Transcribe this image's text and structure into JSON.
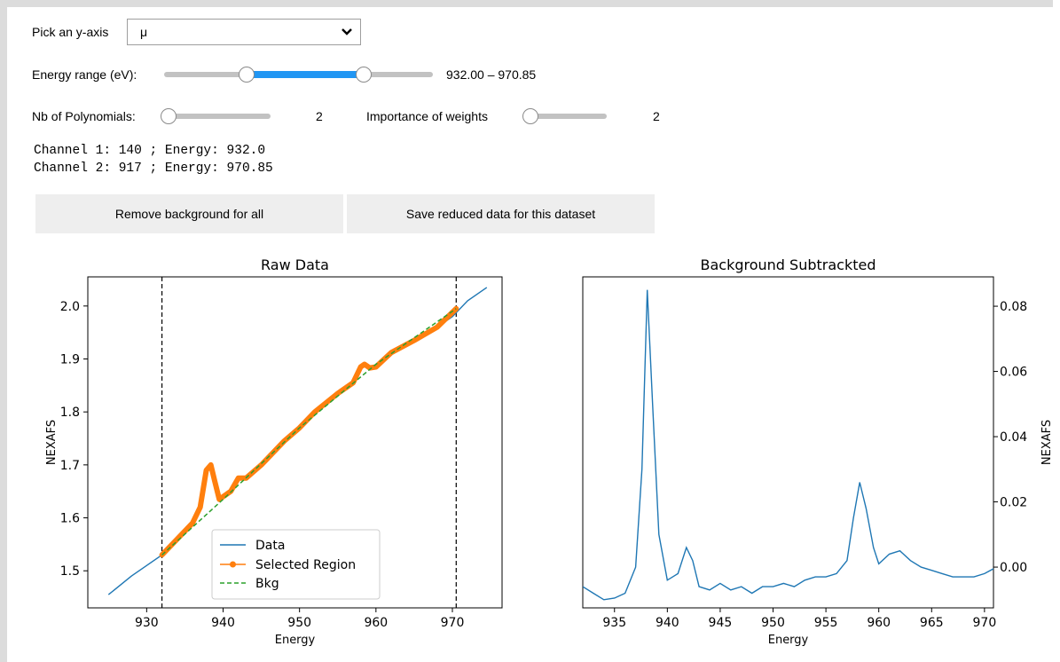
{
  "controls": {
    "yaxis_label": "Pick an y-axis",
    "yaxis_value": "μ",
    "energy_label": "Energy range (eV):",
    "energy_readout": "932.00 – 970.85",
    "energy_range": [
      932.0,
      970.85
    ],
    "poly_label": "Nb of Polynomials:",
    "poly_value": "2",
    "weights_label": "Importance of weights",
    "weights_value": "2",
    "channel_line_1": "Channel 1: 140 ; Energy: 932.0",
    "channel_line_2": "Channel 2: 917 ; Energy: 970.85"
  },
  "buttons": {
    "remove_label": "Remove background for all",
    "save_label": "Save reduced data for this dataset"
  },
  "colors": {
    "slider_fill": "#2196f3",
    "data_line": "#1f77b4",
    "selected": "#ff7f0e",
    "bkg": "#2ca02c"
  },
  "chart_data": [
    {
      "type": "line",
      "title": "Raw Data",
      "xlabel": "Energy",
      "ylabel": "NEXAFS",
      "xlim": [
        922.3,
        976.5
      ],
      "ylim": [
        1.43,
        2.055
      ],
      "xticks": [
        930,
        940,
        950,
        960,
        970
      ],
      "xtick_labels": [
        "930",
        "940",
        "950",
        "960",
        "970"
      ],
      "yticks": [
        1.5,
        1.6,
        1.7,
        1.8,
        1.9,
        2.0
      ],
      "ytick_labels": [
        "1.5",
        "1.6",
        "1.7",
        "1.8",
        "1.9",
        "2.0"
      ],
      "vlines": [
        932.0,
        970.5
      ],
      "legend": [
        "Data",
        "Selected Region",
        "Bkg"
      ],
      "legend_position": "lower center",
      "series": [
        {
          "name": "Data",
          "style": "line",
          "x": [
            925,
            928,
            930,
            932,
            934,
            936,
            937,
            937.8,
            938.4,
            938.9,
            939.5,
            941,
            942,
            943,
            945,
            948,
            950,
            952,
            955,
            957,
            958,
            958.5,
            959.2,
            960,
            962,
            965,
            968,
            970,
            972,
            974.5
          ],
          "y": [
            1.455,
            1.49,
            1.51,
            1.53,
            1.56,
            1.59,
            1.62,
            1.69,
            1.7,
            1.67,
            1.635,
            1.65,
            1.675,
            1.675,
            1.7,
            1.745,
            1.77,
            1.8,
            1.835,
            1.855,
            1.885,
            1.89,
            1.883,
            1.885,
            1.912,
            1.935,
            1.96,
            1.98,
            2.01,
            2.035
          ]
        },
        {
          "name": "Selected Region",
          "style": "markers",
          "x": [
            932,
            934,
            936,
            937,
            937.8,
            938.4,
            938.9,
            939.5,
            941,
            942,
            943,
            945,
            948,
            950,
            952,
            955,
            957,
            958,
            958.5,
            959.2,
            960,
            962,
            965,
            968,
            970.5
          ],
          "y": [
            1.53,
            1.56,
            1.59,
            1.62,
            1.69,
            1.7,
            1.67,
            1.635,
            1.65,
            1.675,
            1.675,
            1.7,
            1.745,
            1.77,
            1.8,
            1.835,
            1.855,
            1.885,
            1.89,
            1.883,
            1.885,
            1.912,
            1.935,
            1.96,
            1.995
          ]
        },
        {
          "name": "Bkg",
          "style": "dashed",
          "x": [
            932,
            940,
            950,
            960,
            970.5
          ],
          "y": [
            1.53,
            1.635,
            1.77,
            1.89,
            1.995
          ]
        }
      ]
    },
    {
      "type": "line",
      "title": "Background Subtrackted",
      "xlabel": "Energy",
      "ylabel": "NEXAFS",
      "xlim": [
        932.0,
        970.85
      ],
      "ylim": [
        -0.0125,
        0.089
      ],
      "xticks": [
        935,
        940,
        945,
        950,
        955,
        960,
        965,
        970
      ],
      "xtick_labels": [
        "935",
        "940",
        "945",
        "950",
        "955",
        "960",
        "965",
        "970"
      ],
      "yticks": [
        0.0,
        0.02,
        0.04,
        0.06,
        0.08
      ],
      "ytick_labels": [
        "0.00",
        "0.02",
        "0.04",
        "0.06",
        "0.08"
      ],
      "series": [
        {
          "name": "",
          "style": "line",
          "x": [
            932,
            933,
            934,
            935,
            936,
            937,
            937.6,
            938.1,
            938.6,
            939.2,
            940,
            941,
            941.8,
            942.4,
            943,
            944,
            945,
            946,
            947,
            948,
            949,
            950,
            951,
            952,
            953,
            954,
            955,
            956,
            957,
            957.6,
            958.2,
            958.8,
            959.5,
            960,
            961,
            962,
            963,
            964,
            965,
            966,
            967,
            968,
            969,
            970,
            970.85
          ],
          "y": [
            -0.006,
            -0.008,
            -0.01,
            -0.0095,
            -0.008,
            0.0,
            0.03,
            0.085,
            0.05,
            0.01,
            -0.004,
            -0.002,
            0.006,
            0.002,
            -0.006,
            -0.007,
            -0.005,
            -0.007,
            -0.006,
            -0.008,
            -0.006,
            -0.006,
            -0.005,
            -0.006,
            -0.004,
            -0.003,
            -0.003,
            -0.002,
            0.002,
            0.015,
            0.026,
            0.018,
            0.006,
            0.001,
            0.004,
            0.005,
            0.002,
            0.0,
            -0.001,
            -0.002,
            -0.003,
            -0.003,
            -0.003,
            -0.002,
            -0.0005
          ]
        }
      ]
    }
  ]
}
